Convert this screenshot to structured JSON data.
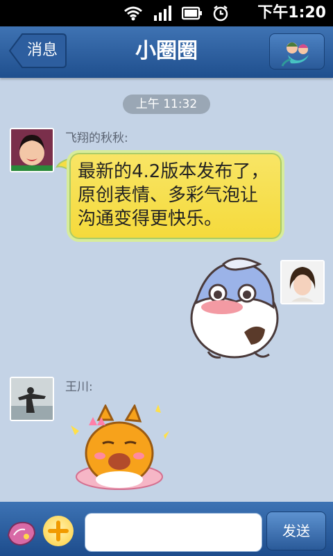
{
  "status_bar": {
    "time": "下午1:20"
  },
  "header": {
    "back_label": "消息",
    "title": "小圈圈"
  },
  "chat": {
    "timestamp": "上午 11:32",
    "messages": [
      {
        "sender": "飞翔的秋秋:",
        "text": "最新的4.2版本发布了，原创表情、多彩气泡让沟通变得更快乐。"
      },
      {
        "sender": "",
        "text": ""
      },
      {
        "sender": "王川:",
        "text": ""
      }
    ]
  },
  "input_bar": {
    "placeholder": "",
    "send_label": "发送"
  },
  "colors": {
    "title_bar": "#2f63a3",
    "bubble": "#f6dd45",
    "chat_bg": "#c4d3e6"
  }
}
